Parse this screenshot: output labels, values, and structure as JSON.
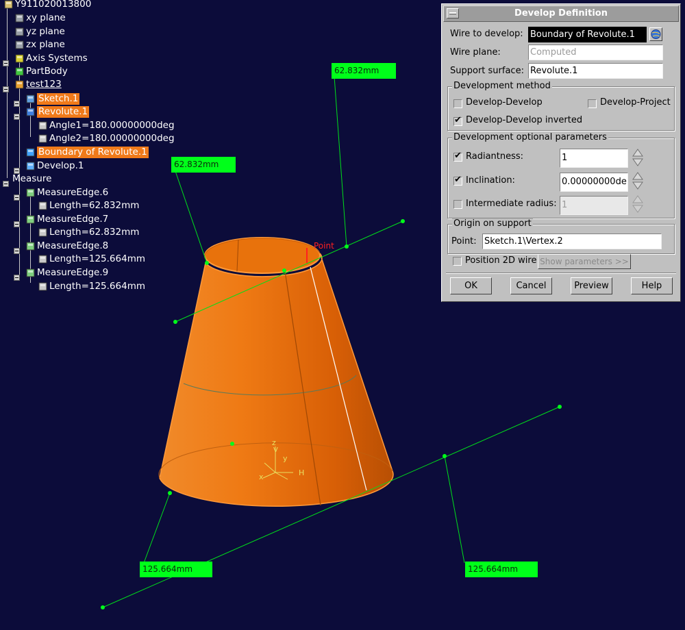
{
  "tree": {
    "items": [
      {
        "label": "Y911020013800",
        "icon": "part-icon"
      },
      {
        "label": "xy plane",
        "icon": "plane-icon"
      },
      {
        "label": "yz plane",
        "icon": "plane-icon"
      },
      {
        "label": "zx plane",
        "icon": "plane-icon"
      },
      {
        "label": "Axis Systems",
        "icon": "axis-icon"
      },
      {
        "label": "PartBody",
        "icon": "gear-icon"
      },
      {
        "label": "test123",
        "icon": "geoset-icon"
      },
      {
        "label": "Sketch.1",
        "icon": "sketch-icon"
      },
      {
        "label": "Revolute.1",
        "icon": "revolute-icon"
      },
      {
        "label": "Angle1=180.00000000deg",
        "icon": "parameter-icon"
      },
      {
        "label": "Angle2=180.00000000deg",
        "icon": "parameter-icon"
      },
      {
        "label": "Boundary of Revolute.1",
        "icon": "boundary-icon"
      },
      {
        "label": "Develop.1",
        "icon": "develop-icon"
      },
      {
        "label": "Measure",
        "icon": ""
      },
      {
        "label": "MeasureEdge.6",
        "icon": "measure-icon"
      },
      {
        "label": "Length=62.832mm",
        "icon": "parameter-icon"
      },
      {
        "label": "MeasureEdge.7",
        "icon": "measure-icon"
      },
      {
        "label": "Length=62.832mm",
        "icon": "parameter-icon"
      },
      {
        "label": "MeasureEdge.8",
        "icon": "measure-icon"
      },
      {
        "label": "Length=125.664mm",
        "icon": "parameter-icon"
      },
      {
        "label": "MeasureEdge.9",
        "icon": "measure-icon"
      },
      {
        "label": "Length=125.664mm",
        "icon": "parameter-icon"
      }
    ]
  },
  "viewport": {
    "labels": [
      "62.832mm",
      "62.832mm",
      "125.664mm",
      "125.664mm"
    ],
    "point_label": "Point",
    "axis": {
      "x": "x",
      "y": "y",
      "z": "z",
      "h": "H",
      "v": "V"
    },
    "colors": {
      "background": "#0c0c3a",
      "cone": "#ee7510",
      "measure": "#00ff1a",
      "point": "#ff2020"
    }
  },
  "dialog": {
    "title": "Develop Definition",
    "wire_to_develop_label": "Wire to develop:",
    "wire_to_develop_value": "Boundary of Revolute.1",
    "wire_plane_label": "Wire plane:",
    "wire_plane_value": "Computed",
    "support_surface_label": "Support surface:",
    "support_surface_value": "Revolute.1",
    "method": {
      "title": "Development method",
      "develop_develop": "Develop-Develop",
      "develop_project": "Develop-Project",
      "develop_inverted": "Develop-Develop inverted"
    },
    "optional": {
      "title": "Development optional parameters",
      "radiantness_label": "Radiantness:",
      "radiantness_value": "1",
      "inclination_label": "Inclination:",
      "inclination_value": "0.00000000de",
      "intermediate_label": "Intermediate radius:",
      "intermediate_value": "1"
    },
    "origin": {
      "title": "Origin on support",
      "point_label": "Point:",
      "point_value": "Sketch.1\\Vertex.2"
    },
    "position_2d_label": "Position 2D wire",
    "show_parameters": "Show parameters >>",
    "buttons": {
      "ok": "OK",
      "cancel": "Cancel",
      "preview": "Preview",
      "help": "Help"
    }
  }
}
